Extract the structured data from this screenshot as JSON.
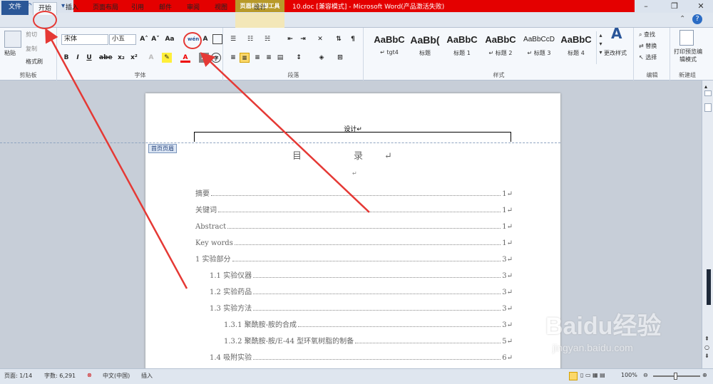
{
  "window": {
    "title": "10.doc [兼容模式] - Microsoft Word(产品激活失败)",
    "context_tool": "页眉和页脚工具",
    "context_tab": "设计",
    "qat_icons": [
      "word-logo-icon",
      "save-icon",
      "undo-icon",
      "redo-icon",
      "preview-icon",
      "customize-icon"
    ],
    "logo_letter": "W",
    "controls": {
      "help": "?"
    }
  },
  "tabs": [
    {
      "label": "文件"
    },
    {
      "label": "开始"
    },
    {
      "label": "插入"
    },
    {
      "label": "页面布局"
    },
    {
      "label": "引用"
    },
    {
      "label": "邮件"
    },
    {
      "label": "审阅"
    },
    {
      "label": "视图"
    }
  ],
  "ribbon": {
    "clipboard": {
      "label": "剪贴板",
      "paste": "粘贴",
      "cut": "剪切",
      "copy": "复制",
      "format_painter": "格式刷"
    },
    "font": {
      "label": "字体",
      "font_name": "宋体",
      "font_size": "小五",
      "bold": "B",
      "italic": "I",
      "underline": "U",
      "strike": "abe",
      "sub": "x₂",
      "sup": "x²",
      "grow": "A˄",
      "shrink": "A˅",
      "case": "Aa",
      "font_color": "A",
      "pinyin": "wén",
      "border_char": "A",
      "circle_char": "字"
    },
    "paragraph": {
      "label": "段落"
    },
    "styles": {
      "label": "样式",
      "items": [
        {
          "sample": "AaBbC",
          "name": "↵ tgt4"
        },
        {
          "sample": "AaBb(",
          "name": "标题"
        },
        {
          "sample": "AaBbC",
          "name": "标题 1"
        },
        {
          "sample": "AaBbC",
          "name": "↵ 标题 2"
        },
        {
          "sample": "AaBbCcD",
          "name": "↵ 标题 3"
        },
        {
          "sample": "AaBbC",
          "name": "标题 4"
        }
      ],
      "change_styles": "更改样式"
    },
    "editing": {
      "label": "编辑",
      "find": "查找",
      "replace": "替换",
      "select": "选择"
    },
    "newgroup": {
      "label": "新建组",
      "print_preview": "打印预览编辑模式"
    }
  },
  "document": {
    "header_text": "设计↵",
    "header_tag": "首页页眉",
    "toc_title": "目　录↵",
    "para_mark": "↵",
    "toc": [
      {
        "text": "摘要",
        "page": "1↵",
        "level": 1
      },
      {
        "text": "关键词",
        "page": "1↵",
        "level": 1
      },
      {
        "text": "Abstract",
        "page": "1↵",
        "level": 1
      },
      {
        "text": "Key words",
        "page": "1↵",
        "level": 1
      },
      {
        "text": "1  实验部分",
        "page": "3↵",
        "level": 1
      },
      {
        "text": "1.1  实验仪器",
        "page": "3↵",
        "level": 2
      },
      {
        "text": "1.2  实验药品",
        "page": "3↵",
        "level": 2
      },
      {
        "text": "1.3  实验方法",
        "page": "3↵",
        "level": 2
      },
      {
        "text": "1.3.1  聚酰胺-胺的合成",
        "page": "3↵",
        "level": 3
      },
      {
        "text": "1.3.2  聚酰胺-胺/E-44 型环氧树脂的制备",
        "page": "5↵",
        "level": 3
      },
      {
        "text": "1.4  吸附实验",
        "page": "6↵",
        "level": 2
      }
    ]
  },
  "status": {
    "page": "页面: 1/14",
    "words": "字数: 6,291",
    "lang": "中文(中国)",
    "mode": "插入",
    "zoom": "100%"
  },
  "watermark": {
    "brand": "Baidu经验",
    "site": "jingyan.baidu.com"
  }
}
